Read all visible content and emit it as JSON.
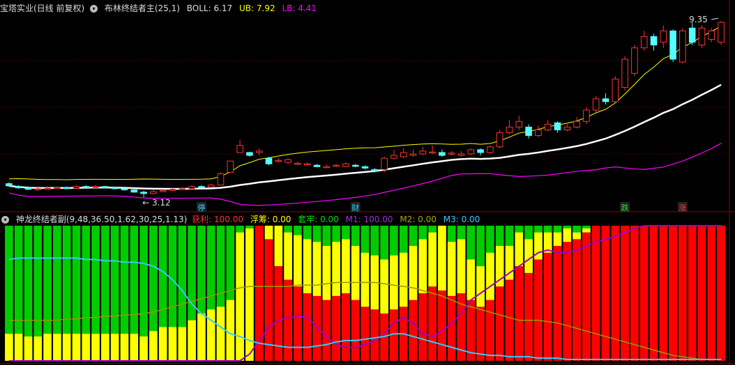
{
  "main": {
    "stock_name": "宝塔实业(日线 前复权)",
    "indicator_name": "布林终结者主(25,1)",
    "boll_label": "BOLL: 6.17",
    "ub_label": "UB: 7.92",
    "lb_label": "LB: 4.41",
    "high_annotation": "9.35",
    "low_annotation": "3.12",
    "markers": [
      "停",
      "财",
      "跌",
      "涨"
    ],
    "colors": {
      "boll": "#ffffff",
      "ub": "#ffff00",
      "lb": "#ff00ff",
      "up": "#ff3333",
      "down": "#55ffff",
      "grid": "#550000"
    }
  },
  "sub": {
    "indicator_name": "神龙终结者副(9,48,36.50,1.62,30,25,1.13)",
    "profit_label": "获利: 100.00",
    "float_label": "浮筹: 0.00",
    "trapped_label": "套牢: 0.00",
    "m1_label": "M1: 100.00",
    "m2_label": "M2: 0.00",
    "m3_label": "M3: 0.00",
    "colors": {
      "profit": "#ff0000",
      "float": "#ffff00",
      "trapped": "#00cc00",
      "m1": "#9900cc",
      "m2": "#999900",
      "m3": "#33ccff"
    }
  },
  "chart_data": {
    "type": "bar",
    "candles": [
      [
        3.6,
        3.52,
        3.65,
        3.5
      ],
      [
        3.5,
        3.45,
        3.55,
        3.42
      ],
      [
        3.45,
        3.4,
        3.5,
        3.38
      ],
      [
        3.4,
        3.42,
        3.5,
        3.35
      ],
      [
        3.42,
        3.44,
        3.5,
        3.4
      ],
      [
        3.44,
        3.46,
        3.5,
        3.42
      ],
      [
        3.46,
        3.44,
        3.5,
        3.4
      ],
      [
        3.44,
        3.5,
        3.55,
        3.42
      ],
      [
        3.5,
        3.48,
        3.55,
        3.45
      ],
      [
        3.48,
        3.5,
        3.55,
        3.45
      ],
      [
        3.5,
        3.46,
        3.52,
        3.44
      ],
      [
        3.46,
        3.42,
        3.5,
        3.4
      ],
      [
        3.42,
        3.38,
        3.45,
        3.35
      ],
      [
        3.38,
        3.3,
        3.4,
        3.28
      ],
      [
        3.3,
        3.25,
        3.35,
        3.12
      ],
      [
        3.25,
        3.32,
        3.38,
        3.22
      ],
      [
        3.32,
        3.36,
        3.4,
        3.3
      ],
      [
        3.36,
        3.4,
        3.45,
        3.34
      ],
      [
        3.4,
        3.42,
        3.48,
        3.38
      ],
      [
        3.42,
        3.5,
        3.55,
        3.4
      ],
      [
        3.5,
        3.48,
        3.55,
        3.45
      ],
      [
        3.48,
        3.55,
        3.6,
        3.46
      ],
      [
        3.55,
        3.95,
        4.0,
        3.55
      ],
      [
        4.0,
        4.4,
        4.4,
        4.0
      ],
      [
        4.7,
        4.95,
        5.15,
        4.7
      ],
      [
        4.7,
        4.6,
        4.72,
        4.55
      ],
      [
        4.7,
        4.75,
        4.85,
        4.6
      ],
      [
        4.5,
        4.3,
        4.55,
        4.25
      ],
      [
        4.4,
        4.42,
        4.5,
        4.35
      ],
      [
        4.35,
        4.45,
        4.5,
        4.3
      ],
      [
        4.3,
        4.32,
        4.38,
        4.25
      ],
      [
        4.3,
        4.3,
        4.35,
        4.25
      ],
      [
        4.25,
        4.2,
        4.3,
        4.18
      ],
      [
        4.2,
        4.2,
        4.28,
        4.15
      ],
      [
        4.22,
        4.25,
        4.3,
        4.18
      ],
      [
        4.2,
        4.3,
        4.35,
        4.18
      ],
      [
        4.25,
        4.22,
        4.3,
        4.18
      ],
      [
        4.2,
        4.15,
        4.25,
        4.1
      ],
      [
        4.1,
        4.05,
        4.15,
        4.0
      ],
      [
        4.1,
        4.5,
        4.55,
        4.0
      ],
      [
        4.5,
        4.6,
        4.8,
        4.45
      ],
      [
        4.55,
        4.7,
        4.85,
        4.5
      ],
      [
        4.6,
        4.65,
        4.8,
        4.55
      ],
      [
        4.65,
        4.75,
        4.9,
        4.6
      ],
      [
        4.7,
        4.72,
        4.95,
        4.65
      ],
      [
        4.7,
        4.6,
        4.8,
        4.55
      ],
      [
        4.65,
        4.68,
        4.75,
        4.6
      ],
      [
        4.6,
        4.65,
        4.75,
        4.55
      ],
      [
        4.65,
        4.8,
        4.85,
        4.6
      ],
      [
        4.8,
        4.7,
        4.85,
        4.6
      ],
      [
        4.7,
        4.9,
        4.95,
        4.65
      ],
      [
        4.9,
        5.4,
        5.5,
        4.85
      ],
      [
        5.4,
        5.6,
        5.85,
        5.35
      ],
      [
        5.6,
        5.8,
        6.0,
        5.5
      ],
      [
        5.6,
        5.3,
        5.7,
        5.2
      ],
      [
        5.3,
        5.5,
        5.65,
        5.25
      ],
      [
        5.5,
        5.7,
        5.85,
        5.45
      ],
      [
        5.75,
        5.5,
        5.8,
        5.4
      ],
      [
        5.5,
        5.6,
        5.7,
        5.45
      ],
      [
        5.6,
        5.8,
        5.95,
        5.55
      ],
      [
        5.8,
        6.2,
        6.3,
        5.7
      ],
      [
        6.2,
        6.6,
        6.7,
        6.1
      ],
      [
        6.6,
        6.5,
        6.8,
        6.4
      ],
      [
        6.5,
        7.3,
        7.4,
        6.45
      ],
      [
        7.0,
        8.0,
        8.1,
        6.9
      ],
      [
        7.5,
        8.4,
        8.5,
        7.4
      ],
      [
        8.4,
        8.8,
        9.0,
        8.3
      ],
      [
        8.8,
        8.5,
        8.9,
        8.3
      ],
      [
        8.6,
        9.0,
        9.2,
        8.4
      ],
      [
        9.0,
        8.0,
        9.05,
        7.9
      ],
      [
        7.9,
        9.0,
        9.1,
        7.85
      ],
      [
        9.1,
        8.6,
        9.3,
        8.5
      ],
      [
        8.5,
        9.1,
        9.2,
        8.4
      ],
      [
        8.7,
        9.0,
        9.1,
        8.6
      ],
      [
        8.6,
        9.3,
        9.35,
        8.5
      ]
    ],
    "ylim": [
      3.0,
      9.6
    ],
    "sub_profit": [
      20,
      20,
      18,
      18,
      20,
      20,
      20,
      20,
      20,
      20,
      20,
      20,
      20,
      20,
      18,
      22,
      25,
      25,
      25,
      30,
      35,
      38,
      40,
      45,
      55,
      60,
      100,
      90,
      70,
      60,
      55,
      50,
      48,
      45,
      48,
      50,
      45,
      40,
      38,
      35,
      38,
      40,
      45,
      50,
      55,
      52,
      48,
      50,
      45,
      40,
      45,
      55,
      60,
      70,
      65,
      75,
      80,
      85,
      88,
      90,
      95,
      100,
      100,
      100,
      100,
      100,
      100,
      100,
      100,
      100,
      100,
      100,
      100,
      100,
      100
    ],
    "sub_float": [
      0,
      0,
      0,
      0,
      0,
      0,
      0,
      0,
      0,
      0,
      0,
      0,
      0,
      0,
      0,
      0,
      0,
      0,
      0,
      0,
      0,
      0,
      0,
      0,
      40,
      38,
      0,
      10,
      30,
      35,
      38,
      40,
      40,
      40,
      40,
      40,
      40,
      40,
      40,
      40,
      40,
      40,
      40,
      40,
      40,
      48,
      40,
      40,
      30,
      30,
      35,
      30,
      25,
      25,
      25,
      20,
      15,
      10,
      10,
      5,
      3,
      0,
      0,
      0,
      0,
      0,
      0,
      0,
      0,
      0,
      0,
      0,
      0,
      0,
      0
    ],
    "sub_m3": [
      75,
      76,
      76,
      76,
      76,
      76,
      76,
      76,
      75,
      75,
      74,
      74,
      73,
      73,
      72,
      70,
      66,
      60,
      52,
      42,
      35,
      30,
      25,
      20,
      18,
      15,
      13,
      12,
      11,
      10,
      10,
      10,
      11,
      12,
      14,
      15,
      15,
      16,
      17,
      18,
      20,
      20,
      18,
      16,
      14,
      12,
      10,
      8,
      6,
      5,
      4,
      4,
      3,
      3,
      3,
      2,
      2,
      2,
      1,
      1,
      1,
      1,
      1,
      1,
      1,
      1,
      1,
      1,
      1,
      1,
      1,
      1,
      1,
      1,
      1
    ],
    "sub_m2": [
      30,
      30,
      30,
      30,
      30,
      30,
      31,
      31,
      32,
      32,
      33,
      33,
      34,
      34,
      35,
      36,
      38,
      40,
      42,
      44,
      46,
      48,
      50,
      52,
      54,
      55,
      55,
      55,
      55,
      55,
      56,
      56,
      56,
      57,
      58,
      58,
      58,
      58,
      58,
      57,
      56,
      55,
      54,
      52,
      50,
      48,
      45,
      42,
      40,
      38,
      36,
      34,
      32,
      30,
      30,
      30,
      29,
      28,
      26,
      24,
      22,
      20,
      18,
      16,
      14,
      12,
      10,
      8,
      6,
      4,
      3,
      2,
      1,
      1,
      1
    ],
    "sub_m1": [
      0,
      0,
      0,
      0,
      0,
      0,
      0,
      0,
      0,
      0,
      0,
      0,
      0,
      0,
      0,
      0,
      0,
      0,
      0,
      0,
      0,
      0,
      0,
      0,
      0,
      5,
      15,
      25,
      30,
      32,
      33,
      32,
      25,
      18,
      12,
      10,
      10,
      12,
      15,
      20,
      28,
      32,
      28,
      20,
      18,
      22,
      28,
      35,
      45,
      50,
      55,
      60,
      65,
      70,
      75,
      80,
      82,
      80,
      80,
      82,
      85,
      88,
      90,
      92,
      95,
      98,
      100,
      100,
      100,
      100,
      100,
      100,
      100,
      100,
      100
    ]
  }
}
